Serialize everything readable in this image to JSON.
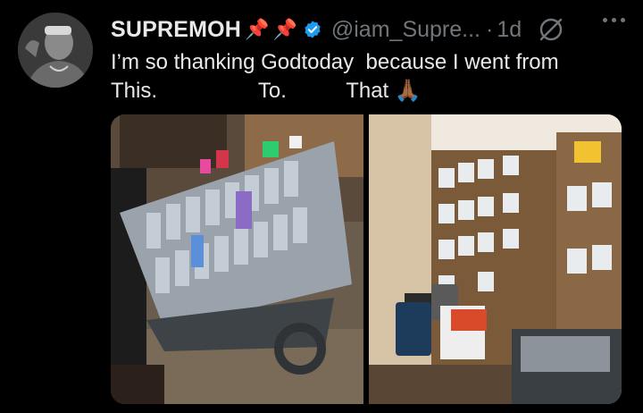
{
  "tweet": {
    "display_name": "SUPREMOH",
    "pin_emoji_1": "📌",
    "pin_emoji_2": "📌",
    "handle": "@iam_Supre...",
    "separator": "·",
    "time": "1d",
    "text_line1": "I’m so thanking Godtoday  because I went from",
    "text_line2": "This.                 To.          That 🙏🏾"
  },
  "icons": {
    "verified": "verified-badge-icon",
    "grok": "grok-icon",
    "more": "more-options-icon"
  },
  "colors": {
    "background": "#000000",
    "text": "#e7e9ea",
    "muted": "#71767b",
    "verified_blue": "#1d9bf0"
  }
}
